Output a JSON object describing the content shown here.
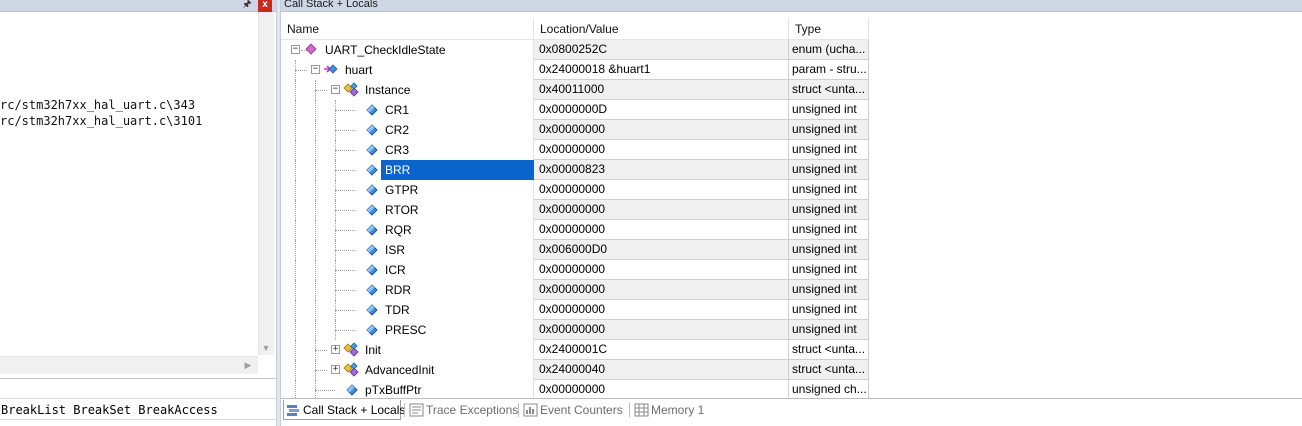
{
  "left_pane": {
    "output_lines": [
      "rc/stm32h7xx_hal_uart.c\\343",
      "rc/stm32h7xx_hal_uart.c\\3101"
    ],
    "command_line": "BreakList BreakSet BreakAccess"
  },
  "right_pane": {
    "title": "Call Stack + Locals",
    "columns": {
      "name": "Name",
      "location": "Location/Value",
      "type": "Type"
    },
    "rows": [
      {
        "name": "UART_CheckIdleState",
        "value": "0x0800252C",
        "type": "enum (ucha...",
        "expander": "−",
        "icon": "function-icon",
        "depth": 0
      },
      {
        "name": "huart",
        "value": "0x24000018 &huart1",
        "type": "param - stru...",
        "expander": "−",
        "icon": "parameter-icon",
        "depth": 1
      },
      {
        "name": "Instance",
        "value": "0x40011000",
        "type": "struct <unta...",
        "expander": "−",
        "icon": "struct-icon",
        "depth": 2
      },
      {
        "name": "CR1",
        "value": "0x0000000D",
        "type": "unsigned int",
        "icon": "variable-icon",
        "depth": 3
      },
      {
        "name": "CR2",
        "value": "0x00000000",
        "type": "unsigned int",
        "icon": "variable-icon",
        "depth": 3
      },
      {
        "name": "CR3",
        "value": "0x00000000",
        "type": "unsigned int",
        "icon": "variable-icon",
        "depth": 3
      },
      {
        "name": "BRR",
        "value": "0x00000823",
        "type": "unsigned int",
        "icon": "variable-icon",
        "depth": 3,
        "selected": true
      },
      {
        "name": "GTPR",
        "value": "0x00000000",
        "type": "unsigned int",
        "icon": "variable-icon",
        "depth": 3
      },
      {
        "name": "RTOR",
        "value": "0x00000000",
        "type": "unsigned int",
        "icon": "variable-icon",
        "depth": 3
      },
      {
        "name": "RQR",
        "value": "0x00000000",
        "type": "unsigned int",
        "icon": "variable-icon",
        "depth": 3
      },
      {
        "name": "ISR",
        "value": "0x006000D0",
        "type": "unsigned int",
        "icon": "variable-icon",
        "depth": 3
      },
      {
        "name": "ICR",
        "value": "0x00000000",
        "type": "unsigned int",
        "icon": "variable-icon",
        "depth": 3
      },
      {
        "name": "RDR",
        "value": "0x00000000",
        "type": "unsigned int",
        "icon": "variable-icon",
        "depth": 3
      },
      {
        "name": "TDR",
        "value": "0x00000000",
        "type": "unsigned int",
        "icon": "variable-icon",
        "depth": 3
      },
      {
        "name": "PRESC",
        "value": "0x00000000",
        "type": "unsigned int",
        "icon": "variable-icon",
        "depth": 3
      },
      {
        "name": "Init",
        "value": "0x2400001C",
        "type": "struct <unta...",
        "expander": "+",
        "icon": "struct-icon",
        "depth": 2
      },
      {
        "name": "AdvancedInit",
        "value": "0x24000040",
        "type": "struct <unta...",
        "expander": "+",
        "icon": "struct-icon",
        "depth": 2
      },
      {
        "name": "pTxBuffPtr",
        "value": "0x00000000",
        "type": "unsigned ch...",
        "icon": "variable-icon",
        "depth": 2
      }
    ]
  },
  "tabs": [
    {
      "label": "Call Stack + Locals",
      "active": true,
      "icon": "call-stack-icon"
    },
    {
      "label": "Trace Exceptions",
      "active": false,
      "icon": "trace-exceptions-icon"
    },
    {
      "label": "Event Counters",
      "active": false,
      "icon": "event-counters-icon"
    },
    {
      "label": "Memory 1",
      "active": false,
      "icon": "memory-icon"
    }
  ],
  "colors": {
    "selection": "#0A64CB",
    "titlebar": "#CFD6E5",
    "close_button": "#C42B1C"
  }
}
